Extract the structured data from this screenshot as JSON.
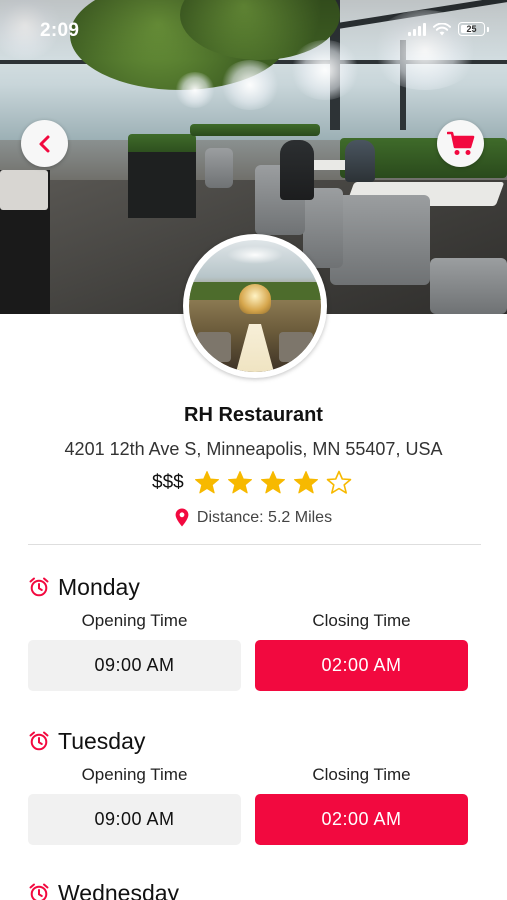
{
  "status_bar": {
    "time": "2:09",
    "battery": "25"
  },
  "colors": {
    "accent": "#f2093f",
    "star": "#f7b900",
    "open_box": "#f1f1f1"
  },
  "icons": {
    "back": "chevron-left-icon",
    "cart": "shopping-cart-icon",
    "pin": "location-pin-icon",
    "alarm": "alarm-clock-icon"
  },
  "restaurant": {
    "name": "RH Restaurant",
    "address": "4201 12th Ave S, Minneapolis, MN 55407, USA",
    "price": "$$$",
    "rating": 4,
    "rating_max": 5,
    "distance": "Distance: 5.2 Miles"
  },
  "schedule": {
    "opening_label": "Opening Time",
    "closing_label": "Closing Time",
    "days": [
      {
        "day": "Monday",
        "open": "09:00 AM",
        "close": "02:00 AM"
      },
      {
        "day": "Tuesday",
        "open": "09:00 AM",
        "close": "02:00 AM"
      },
      {
        "day": "Wednesday"
      }
    ]
  }
}
